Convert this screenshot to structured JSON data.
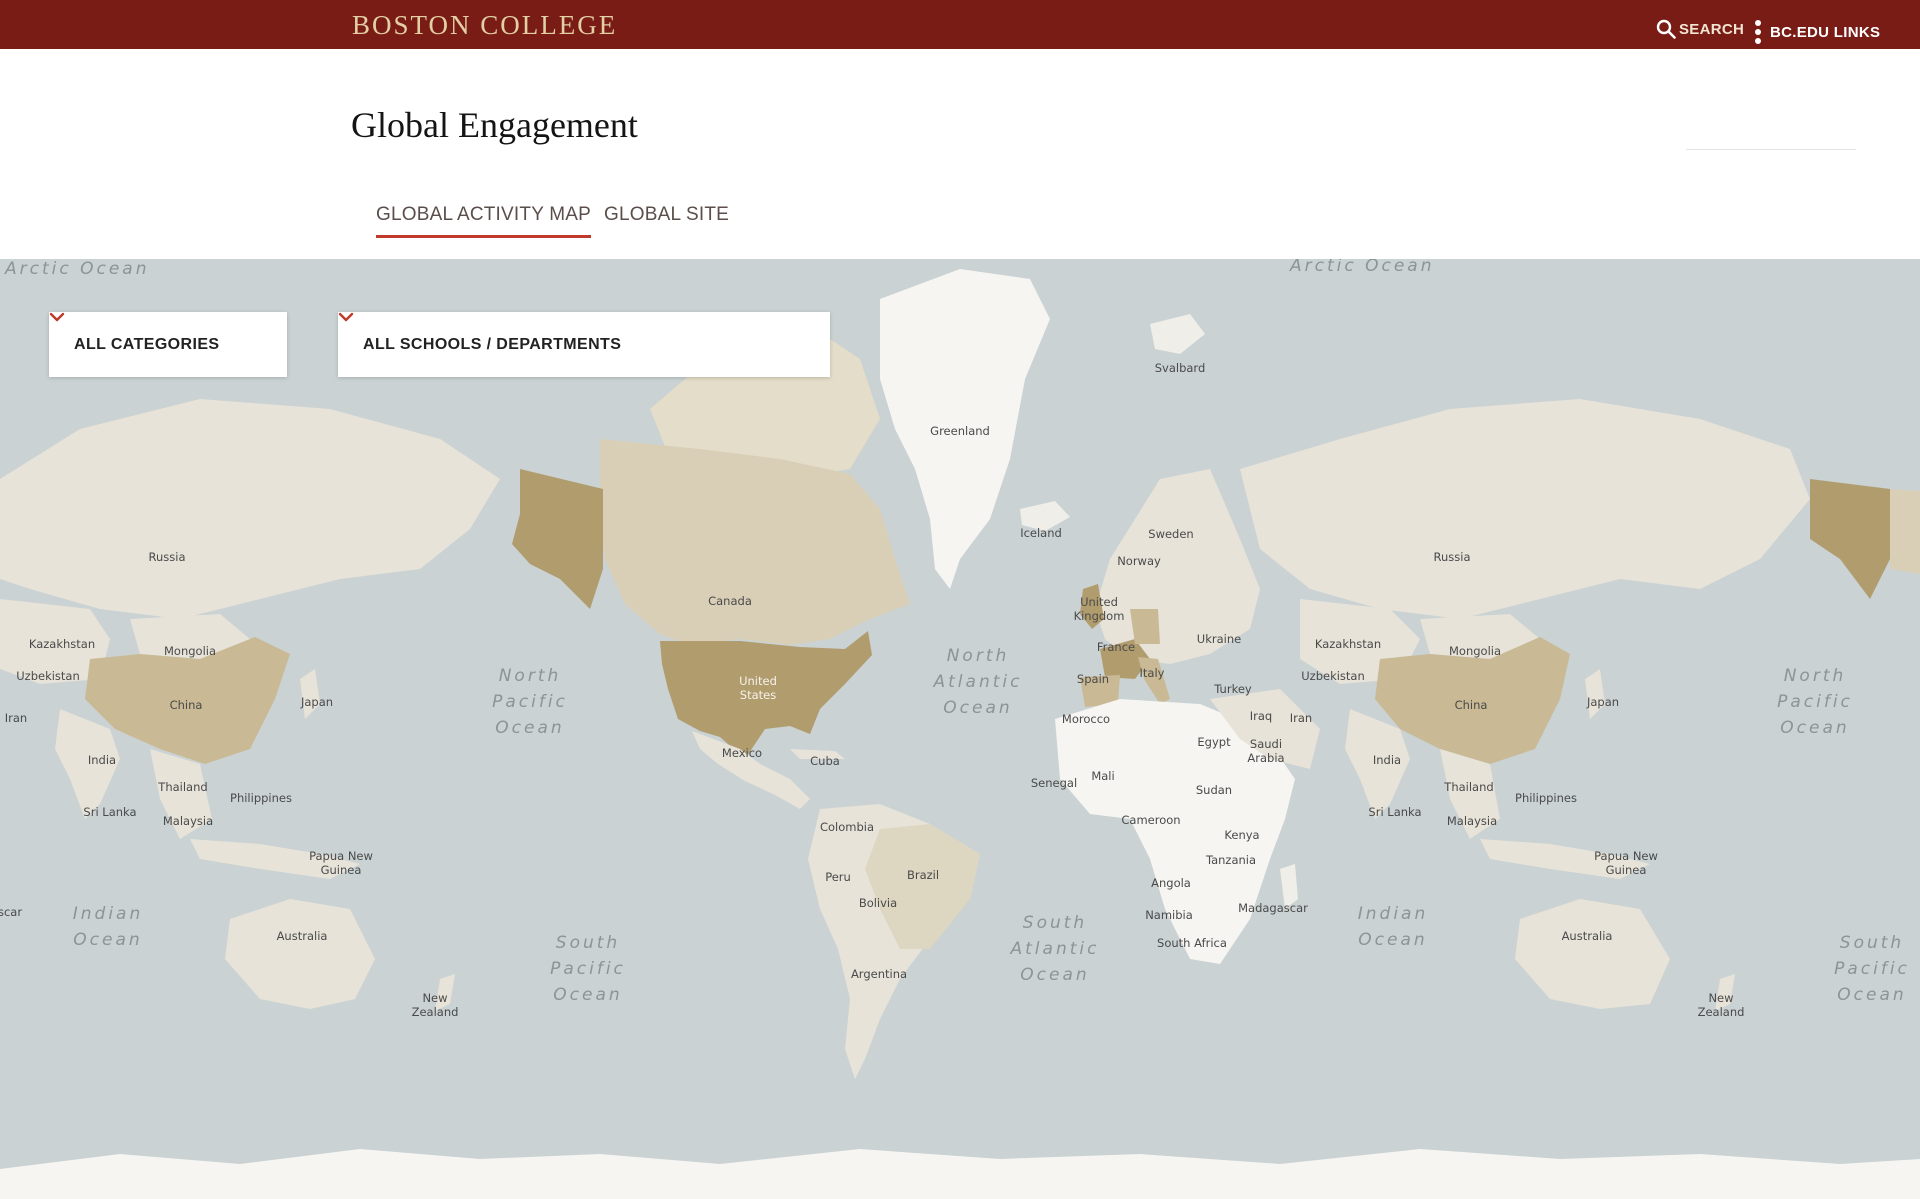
{
  "header": {
    "logo": "BOSTON COLLEGE",
    "search_label": "SEARCH",
    "links_label": "BC.EDU LINKS"
  },
  "page": {
    "title": "Global Engagement"
  },
  "tabs": [
    {
      "label": "GLOBAL ACTIVITY MAP",
      "active": true
    },
    {
      "label": "GLOBAL SITE",
      "active": false
    }
  ],
  "filters": {
    "categories": {
      "selected": "ALL CATEGORIES"
    },
    "schools": {
      "selected": "ALL SCHOOLS / DEPARTMENTS"
    }
  },
  "map": {
    "oceans": {
      "arctic": "Arctic Ocean",
      "north": "North",
      "south": "South",
      "pacific": "Pacific",
      "atlantic": "Atlantic",
      "ocean": "Ocean",
      "indian": "Indian"
    },
    "countries": {
      "greenland": "Greenland",
      "svalbard": "Svalbard",
      "iceland": "Iceland",
      "sweden": "Sweden",
      "norway": "Norway",
      "uk_1": "United",
      "uk_2": "Kingdom",
      "france": "France",
      "spain": "Spain",
      "italy": "Italy",
      "ukraine": "Ukraine",
      "turkey": "Turkey",
      "iraq": "Iraq",
      "iran": "Iran",
      "saudi_1": "Saudi",
      "saudi_2": "Arabia",
      "egypt": "Egypt",
      "morocco": "Morocco",
      "mali": "Mali",
      "senegal": "Senegal",
      "sudan": "Sudan",
      "cameroon": "Cameroon",
      "kenya": "Kenya",
      "tanzania": "Tanzania",
      "angola": "Angola",
      "namibia": "Namibia",
      "madagascar": "Madagascar",
      "south_africa": "South Africa",
      "russia": "Russia",
      "kazakhstan": "Kazakhstan",
      "uzbekistan": "Uzbekistan",
      "mongolia": "Mongolia",
      "china": "China",
      "japan": "Japan",
      "india": "India",
      "thailand": "Thailand",
      "philippines": "Philippines",
      "sri_lanka": "Sri Lanka",
      "malaysia": "Malaysia",
      "png_1": "Papua New",
      "png_2": "Guinea",
      "australia": "Australia",
      "nz_1": "New",
      "nz_2": "Zealand",
      "canada": "Canada",
      "us_1": "United",
      "us_2": "States",
      "mexico": "Mexico",
      "cuba": "Cuba",
      "colombia": "Colombia",
      "peru": "Peru",
      "brazil": "Brazil",
      "bolivia": "Bolivia",
      "argentina": "Argentina",
      "madagascar_edge": "scar"
    }
  },
  "colors": {
    "header_bg": "#7a1c16",
    "logo": "#e2cfa4",
    "accent": "#c0392b",
    "water": "#cad2d3",
    "land": "#e7e3d9",
    "land_white": "#f6f5f2",
    "activity_light": "#d9cfb7",
    "activity_mid": "#c9b995",
    "activity_dark": "#b19c6e"
  }
}
